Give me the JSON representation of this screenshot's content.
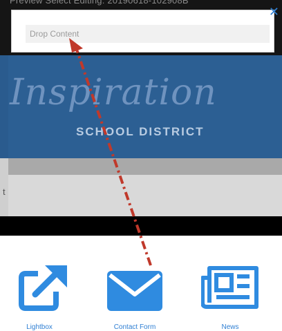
{
  "header": {
    "breadcrumb_text": "Preview  Select  Editing: 20190618-102908B",
    "close_icon": "close-icon"
  },
  "drop_zone": {
    "placeholder": "Drop Content"
  },
  "banner": {
    "logo_script": "Inspiration",
    "logo_subtitle": "SCHOOL DISTRICT",
    "background_color": "#2c5f93"
  },
  "menu_band": {
    "partial_text": "t"
  },
  "widgets": [
    {
      "label": "Lightbox",
      "icon": "external-link-icon"
    },
    {
      "label": "Contact Form",
      "icon": "envelope-icon"
    },
    {
      "label": "News",
      "icon": "newspaper-icon"
    }
  ],
  "drag_indicator": {
    "color": "#c0392b",
    "icon": "dash-dot-arrow"
  },
  "accent_color": "#2f7fd3"
}
